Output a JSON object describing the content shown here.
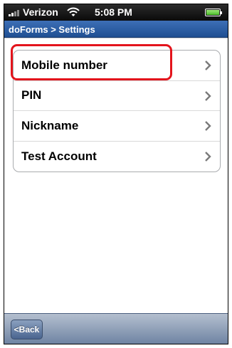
{
  "status_bar": {
    "carrier": "Verizon",
    "time": "5:08 PM",
    "icons": [
      "signal-icon",
      "wifi-icon",
      "battery-icon"
    ]
  },
  "header": {
    "breadcrumb": "doForms > Settings"
  },
  "settings": {
    "items": [
      {
        "label": "Mobile number"
      },
      {
        "label": "PIN"
      },
      {
        "label": "Nickname"
      },
      {
        "label": "Test Account"
      }
    ]
  },
  "toolbar": {
    "back_label": "<Back"
  },
  "colors": {
    "highlight": "#e3141c",
    "navbar": "#2a5ca3",
    "toolbar": "#8a9cb6"
  }
}
